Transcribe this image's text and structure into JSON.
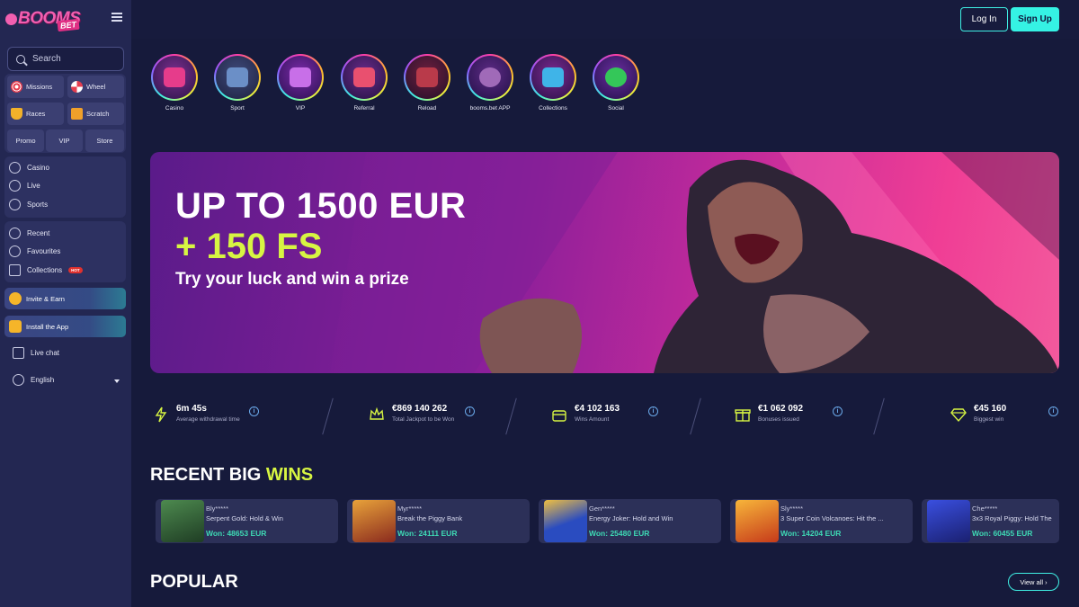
{
  "brand": {
    "logo_text": "BOOMS",
    "logo_suffix": "BET"
  },
  "sidebar": {
    "search_placeholder": "Search",
    "chips": [
      {
        "label": "Missions",
        "icon": "target-icon"
      },
      {
        "label": "Wheel",
        "icon": "wheel-icon"
      },
      {
        "label": "Races",
        "icon": "trophy-icon"
      },
      {
        "label": "Scratch",
        "icon": "scratch-card-icon"
      }
    ],
    "tabs": [
      "Promo",
      "VIP",
      "Store"
    ],
    "nav_main": [
      {
        "label": "Casino",
        "icon": "casino-chip-icon"
      },
      {
        "label": "Live",
        "icon": "live-icon"
      },
      {
        "label": "Sports",
        "icon": "ball-icon"
      }
    ],
    "nav_secondary": [
      {
        "label": "Recent",
        "icon": "history-icon"
      },
      {
        "label": "Favourites",
        "icon": "heart-icon"
      },
      {
        "label": "Collections",
        "icon": "book-icon",
        "badge": "HOT"
      }
    ],
    "promo_buttons": [
      "Invite & Earn",
      "Install the App"
    ],
    "live_chat": "Live chat",
    "language": "English"
  },
  "header": {
    "login": "Log In",
    "signup": "Sign Up"
  },
  "categories": [
    "Casino",
    "Sport",
    "VIP",
    "Referral",
    "Reload",
    "booms.bet APP",
    "Collections",
    "Social"
  ],
  "banner": {
    "title": "UP TO 1500 EUR",
    "subtitle": "+ 150 FS",
    "description": "Try your luck and win a prize"
  },
  "stats": [
    {
      "value": "6m 45s",
      "label": "Average withdrawal time",
      "icon": "lightning-icon"
    },
    {
      "value": "€869 140 262",
      "label": "Total Jackpot to be Won",
      "icon": "crown-icon"
    },
    {
      "value": "€4 102 163",
      "label": "Wins Amount",
      "icon": "chest-icon"
    },
    {
      "value": "€1 062 092",
      "label": "Bonuses issued",
      "icon": "gift-icon"
    },
    {
      "value": "€45 160",
      "label": "Biggest win",
      "icon": "diamond-icon"
    }
  ],
  "recent_wins": {
    "title_main": "RECENT BIG ",
    "title_accent": "WINS",
    "items": [
      {
        "user": "Bly*****",
        "game": "Serpent Gold: Hold & Win",
        "amount": "Won: 48653 EUR",
        "thumb_color": "#2e6b3a"
      },
      {
        "user": "Myr*****",
        "game": "Break the Piggy Bank",
        "amount": "Won: 24111 EUR",
        "thumb_color": "#b2452b"
      },
      {
        "user": "Gen*****",
        "game": "Energy Joker: Hold and Win",
        "amount": "Won: 25480 EUR",
        "thumb_color": "#2750b8"
      },
      {
        "user": "Sly*****",
        "game": "3 Super Coin Volcanoes: Hit the ...",
        "amount": "Won: 14204 EUR",
        "thumb_color": "#d0521e"
      },
      {
        "user": "Che*****",
        "game": "3x3 Royal Piggy: Hold The",
        "amount": "Won: 60455 EUR",
        "thumb_color": "#2a3fc2"
      }
    ]
  },
  "popular": {
    "title": "POPULAR",
    "view_all": "View all ›"
  },
  "colors": {
    "accent": "#35f2e4",
    "lime": "#d7f542",
    "win_green": "#3ed9b4",
    "sidebar_bg": "#232752"
  }
}
